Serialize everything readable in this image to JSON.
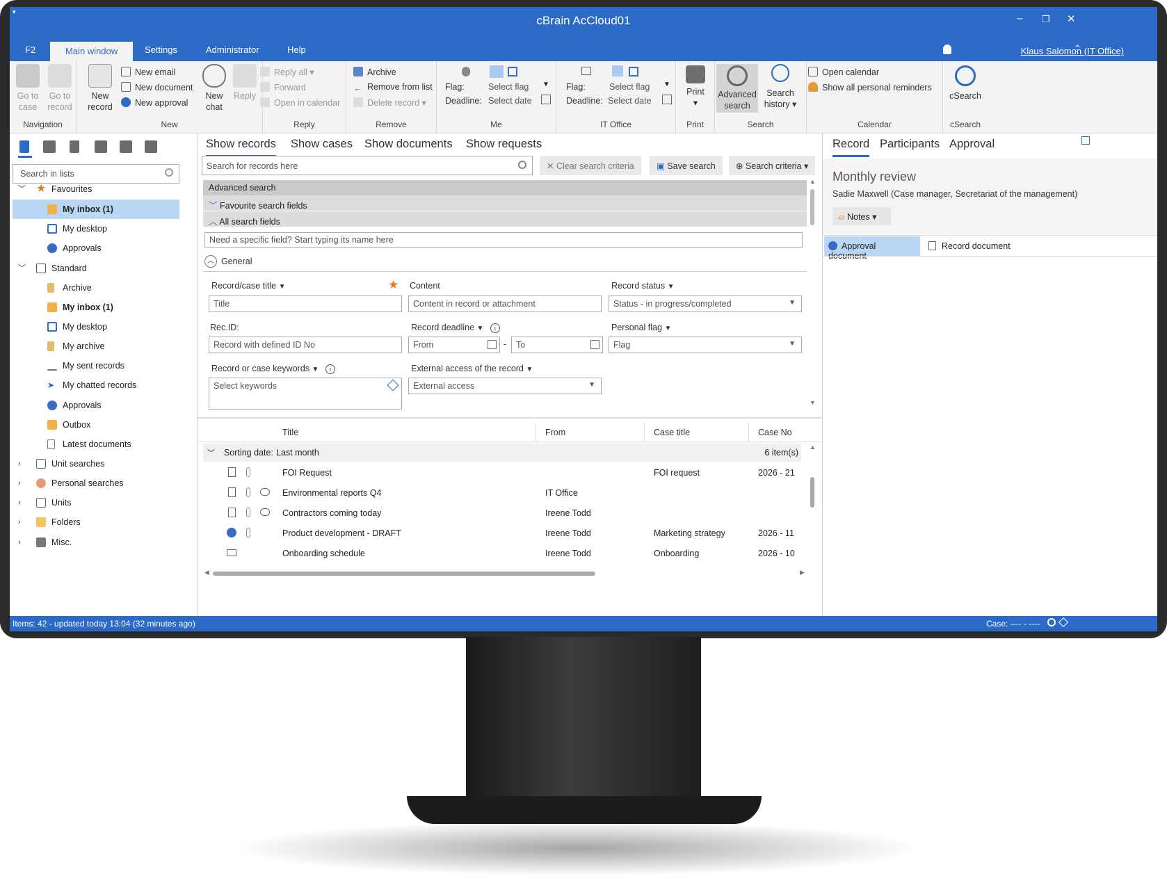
{
  "window": {
    "title": "cBrain AcCloud01",
    "user": "Klaus Salomon (IT Office)"
  },
  "menu": [
    "F2",
    "Main window",
    "Settings",
    "Administrator",
    "Help"
  ],
  "ribbon": {
    "nav": {
      "goto_case": "Go to case",
      "goto_record": "Go to record",
      "label": "Navigation"
    },
    "new": {
      "new_record": "New record",
      "new_email": "New email",
      "new_document": "New document",
      "new_approval": "New approval",
      "new_chat": "New chat",
      "label": "New"
    },
    "reply": {
      "reply": "Reply",
      "reply_all": "Reply all",
      "forward": "Forward",
      "open_calendar": "Open in calendar",
      "label": "Reply"
    },
    "remove": {
      "archive": "Archive",
      "remove_list": "Remove from list",
      "delete": "Delete record",
      "label": "Remove"
    },
    "me": {
      "flag": "Flag:",
      "deadline": "Deadline:",
      "select_flag": "Select flag",
      "select_date": "Select date",
      "label": "Me"
    },
    "it": {
      "flag": "Flag:",
      "deadline": "Deadline:",
      "select_flag": "Select flag",
      "select_date": "Select date",
      "label": "IT Office"
    },
    "print": {
      "print": "Print",
      "label": "Print"
    },
    "search": {
      "advanced": "Advanced search",
      "history": "Search history",
      "label": "Search"
    },
    "calendar": {
      "open": "Open calendar",
      "reminders": "Show all personal reminders",
      "label": "Calendar"
    },
    "csearch": {
      "btn": "cSearch",
      "label": "cSearch"
    }
  },
  "left": {
    "search_placeholder": "Search in lists",
    "tree": [
      {
        "label": "Favourites"
      },
      {
        "label": "My inbox (1)"
      },
      {
        "label": "My desktop"
      },
      {
        "label": "Approvals"
      },
      {
        "label": "Standard"
      },
      {
        "label": "Archive"
      },
      {
        "label": "My inbox (1)"
      },
      {
        "label": "My desktop"
      },
      {
        "label": "My archive"
      },
      {
        "label": "My sent records"
      },
      {
        "label": "My chatted records"
      },
      {
        "label": "Approvals"
      },
      {
        "label": "Outbox"
      },
      {
        "label": "Latest documents"
      },
      {
        "label": "Unit searches"
      },
      {
        "label": "Personal searches"
      },
      {
        "label": "Units"
      },
      {
        "label": "Folders"
      },
      {
        "label": "Misc."
      }
    ]
  },
  "center": {
    "tabs": [
      "Show records",
      "Show cases",
      "Show documents",
      "Show requests"
    ],
    "search_placeholder": "Search for records here",
    "clear": "Clear search criteria",
    "save": "Save search",
    "criteria": "Search criteria",
    "advanced": "Advanced search",
    "favourite_fields": "Favourite search fields",
    "all_fields": "All search fields",
    "field_finder": "Need a specific field? Start typing its name here",
    "general": "General",
    "fields": {
      "title_label": "Record/case title",
      "title_ph": "Title",
      "content_label": "Content",
      "content_ph": "Content in record or attachment",
      "status_label": "Record status",
      "status_val": "Status - in progress/completed",
      "recid_label": "Rec.ID:",
      "recid_ph": "Record with defined ID No",
      "deadline_label": "Record deadline",
      "from_ph": "From",
      "to_ph": "To",
      "dash": "-",
      "pflag_label": "Personal flag",
      "pflag_val": "Flag",
      "keywords_label": "Record or case keywords",
      "keywords_ph": "Select keywords",
      "ext_label": "External access of the record",
      "ext_val": "External access"
    },
    "table": {
      "headers": [
        "Title",
        "From",
        "Case title",
        "Case No"
      ],
      "group": "Sorting date:",
      "group_val": "Last month",
      "count": "6 item(s)",
      "rows": [
        {
          "title": "FOI Request",
          "from": "",
          "case": "FOI request",
          "no": "2026 - 21"
        },
        {
          "title": "Environmental reports Q4",
          "from": "IT Office",
          "case": "",
          "no": ""
        },
        {
          "title": "Contractors coming today",
          "from": "Ireene Todd",
          "case": "",
          "no": ""
        },
        {
          "title": "Product development - DRAFT",
          "from": "Ireene Todd",
          "case": "Marketing strategy",
          "no": "2026 - 11"
        },
        {
          "title": "Onboarding schedule",
          "from": "Ireene Todd",
          "case": "Onboarding",
          "no": "2026 - 10"
        }
      ]
    }
  },
  "right": {
    "tabs": [
      "Record",
      "Participants",
      "Approval"
    ],
    "title": "Monthly review",
    "subtitle": "Sadie Maxwell (Case manager, Secretariat of the management)",
    "notes": "Notes",
    "doc_tabs": [
      "Approval document",
      "Record document"
    ]
  },
  "status": {
    "left": "Items: 42 - updated today 13:04 (32 minutes ago)",
    "right": "Case: ---- - ----"
  },
  "colors": {
    "accent": "#2c6ac8",
    "selection": "#b9d7f3",
    "ribbon": "#f3f3f3"
  }
}
